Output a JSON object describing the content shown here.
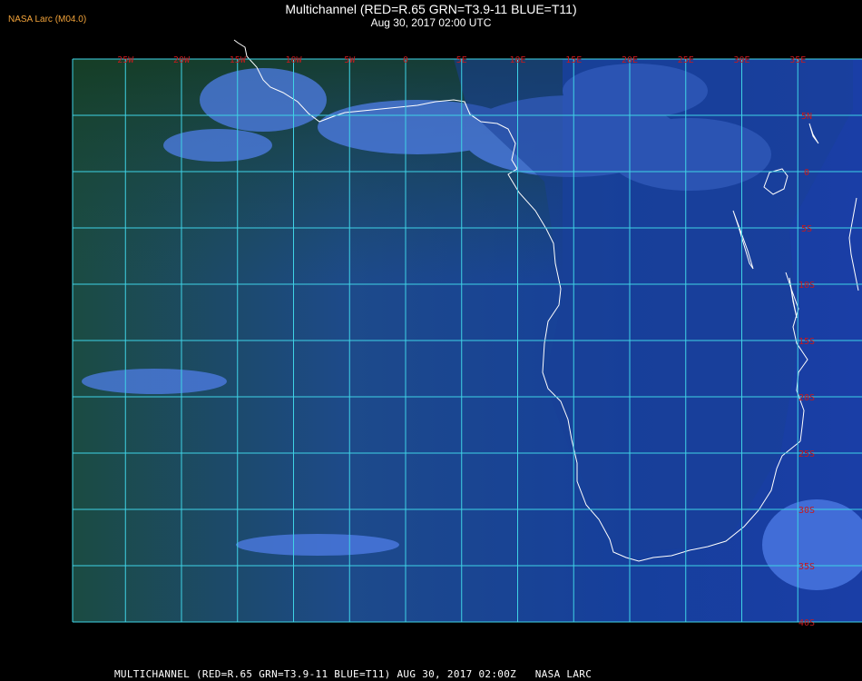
{
  "header": {
    "credit": "NASA Larc (M04.0)",
    "title": "Multichannel (RED=R.65 GRN=T3.9-11 BLUE=T11)",
    "subtitle": "Aug 30, 2017 02:00 UTC"
  },
  "map": {
    "projection": "lat-lon",
    "lon_range": [
      -28,
      35
    ],
    "lat_range": [
      -40,
      10
    ],
    "grid_color": "#3fd3e6",
    "coastline_color": "#ffffff",
    "label_color": "#c8191c",
    "lon_labels": [
      {
        "lon": -25,
        "text": "25W"
      },
      {
        "lon": -20,
        "text": "20W"
      },
      {
        "lon": -15,
        "text": "15W"
      },
      {
        "lon": -10,
        "text": "10W"
      },
      {
        "lon": -5,
        "text": "5W"
      },
      {
        "lon": 0,
        "text": "0"
      },
      {
        "lon": 5,
        "text": "5E"
      },
      {
        "lon": 10,
        "text": "10E"
      },
      {
        "lon": 15,
        "text": "15E"
      },
      {
        "lon": 20,
        "text": "20E"
      },
      {
        "lon": 25,
        "text": "25E"
      },
      {
        "lon": 30,
        "text": "30E"
      },
      {
        "lon": 35,
        "text": "35E"
      }
    ],
    "lat_labels": [
      {
        "lat": 5,
        "text": "5N"
      },
      {
        "lat": 0,
        "text": "0"
      },
      {
        "lat": -5,
        "text": "5S"
      },
      {
        "lat": -10,
        "text": "10S"
      },
      {
        "lat": -15,
        "text": "15S"
      },
      {
        "lat": -20,
        "text": "20S"
      },
      {
        "lat": -25,
        "text": "25S"
      },
      {
        "lat": -30,
        "text": "30S"
      },
      {
        "lat": -35,
        "text": "35S"
      },
      {
        "lat": -40,
        "text": "40S"
      }
    ]
  },
  "footer": {
    "text": "MULTICHANNEL (RED=R.65 GRN=T3.9-11 BLUE=T11) AUG 30, 2017 02:00Z   NASA LARC"
  }
}
